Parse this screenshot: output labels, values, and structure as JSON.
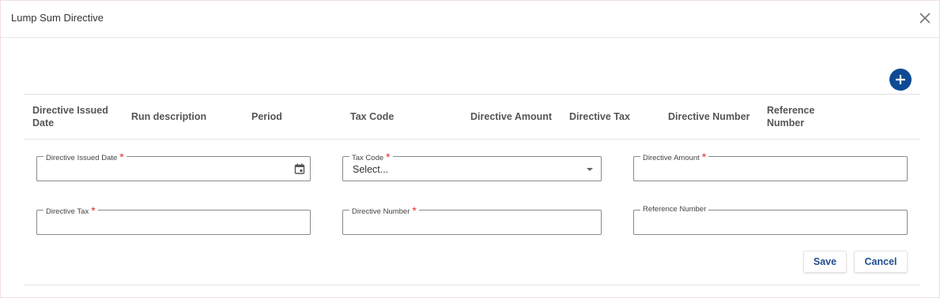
{
  "dialog": {
    "title": "Lump Sum Directive"
  },
  "table": {
    "headers": [
      "Directive Issued Date",
      "Run description",
      "Period",
      "Tax Code",
      "Directive Amount",
      "Directive Tax",
      "Directive Number",
      "Reference Number"
    ]
  },
  "form": {
    "issued_date": {
      "label": "Directive Issued Date",
      "required": "*",
      "value": ""
    },
    "tax_code": {
      "label": "Tax Code",
      "required": "*",
      "value": "Select..."
    },
    "amount": {
      "label": "Directive Amount",
      "required": "*",
      "value": ""
    },
    "tax": {
      "label": "Directive Tax",
      "required": "*",
      "value": ""
    },
    "number": {
      "label": "Directive Number",
      "required": "*",
      "value": ""
    },
    "reference": {
      "label": "Reference Number",
      "value": ""
    }
  },
  "actions": {
    "save": "Save",
    "cancel": "Cancel"
  },
  "colors": {
    "accent": "#0d4a94",
    "required": "#e02b2b",
    "button_text": "#1f4e8c"
  },
  "icons": {
    "close": "close-icon",
    "add": "plus-icon",
    "calendar": "calendar-icon",
    "dropdown": "chevron-down-icon"
  }
}
